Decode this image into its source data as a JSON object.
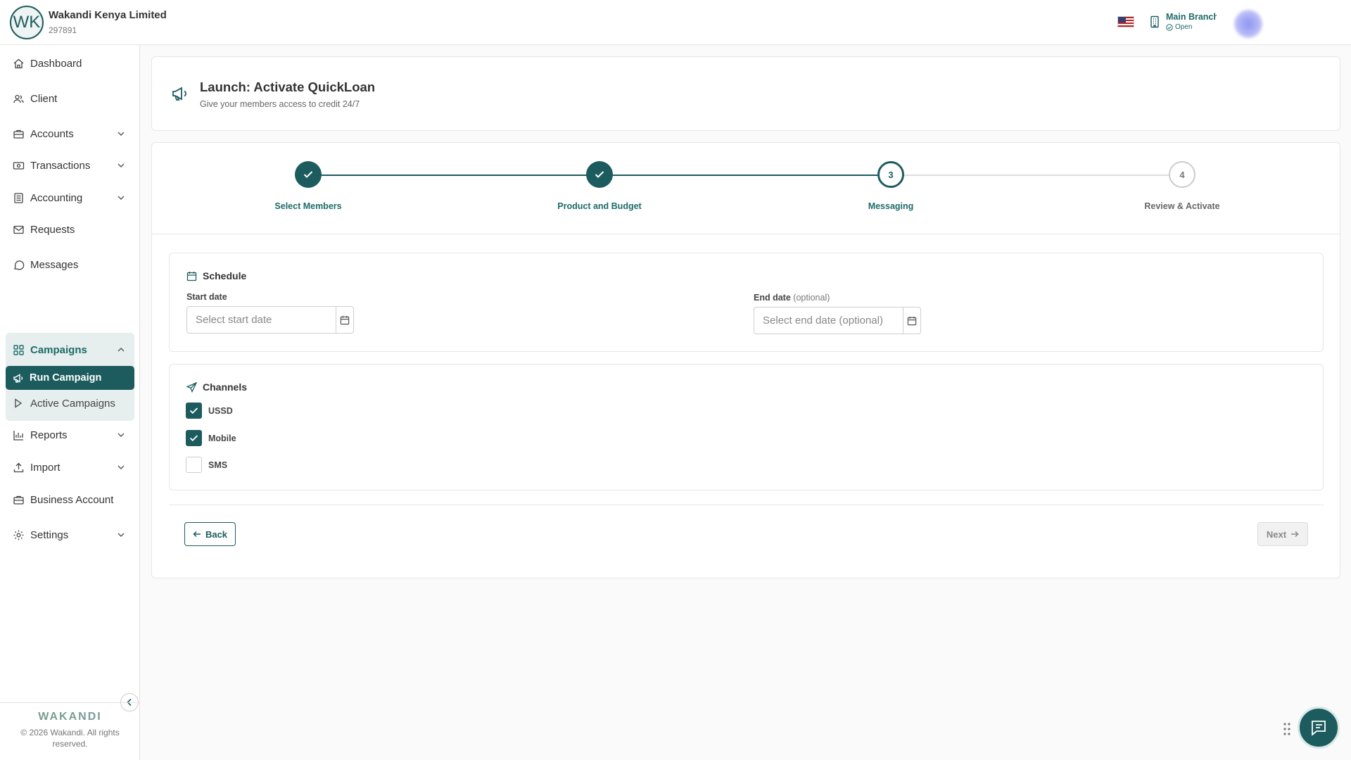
{
  "header": {
    "org_initials": "WK",
    "org_name": "Wakandi Kenya Limited",
    "org_id": "297891",
    "branch_name": "Main Branch",
    "branch_status": "Open"
  },
  "sidebar": {
    "items": [
      {
        "label": "Dashboard",
        "icon": "home-icon"
      },
      {
        "label": "Client",
        "icon": "users-icon"
      },
      {
        "label": "Accounts",
        "icon": "briefcase-icon"
      },
      {
        "label": "Transactions",
        "icon": "cash-icon"
      },
      {
        "label": "Accounting",
        "icon": "ledger-icon"
      },
      {
        "label": "Requests",
        "icon": "mail-icon"
      },
      {
        "label": "Messages",
        "icon": "chat-icon"
      },
      {
        "label": "Campaigns",
        "icon": "grid-icon"
      },
      {
        "label": "Run Campaign",
        "icon": "megaphone-icon"
      },
      {
        "label": "Active Campaigns",
        "icon": "play-icon"
      },
      {
        "label": "Reports",
        "icon": "bar-chart-icon"
      },
      {
        "label": "Import",
        "icon": "upload-icon"
      },
      {
        "label": "Business Account",
        "icon": "briefcase-icon"
      },
      {
        "label": "Settings",
        "icon": "gear-icon"
      }
    ],
    "brand": "WAKANDI",
    "copyright": "© 2026 Wakandi. All rights reserved."
  },
  "page": {
    "title": "Launch: Activate QuickLoan",
    "subtitle": "Give your members access to credit 24/7"
  },
  "stepper": {
    "steps": [
      {
        "number": "1",
        "label": "Select Members",
        "state": "done"
      },
      {
        "number": "2",
        "label": "Product and Budget",
        "state": "done"
      },
      {
        "number": "3",
        "label": "Messaging",
        "state": "current"
      },
      {
        "number": "4",
        "label": "Review & Activate",
        "state": "pending"
      }
    ]
  },
  "schedule": {
    "title": "Schedule",
    "start_label": "Start date",
    "start_placeholder": "Select start date",
    "end_label": "End date",
    "end_optional": "(optional)",
    "end_placeholder": "Select end date (optional)"
  },
  "channels": {
    "title": "Channels",
    "options": [
      {
        "label": "USSD",
        "checked": true
      },
      {
        "label": "Mobile",
        "checked": true
      },
      {
        "label": "SMS",
        "checked": false
      }
    ]
  },
  "actions": {
    "back": "Back",
    "next": "Next"
  },
  "colors": {
    "primary": "#1d5c5e",
    "primary_text": "#1d6b68",
    "campaign_bg": "#e6eeee"
  }
}
